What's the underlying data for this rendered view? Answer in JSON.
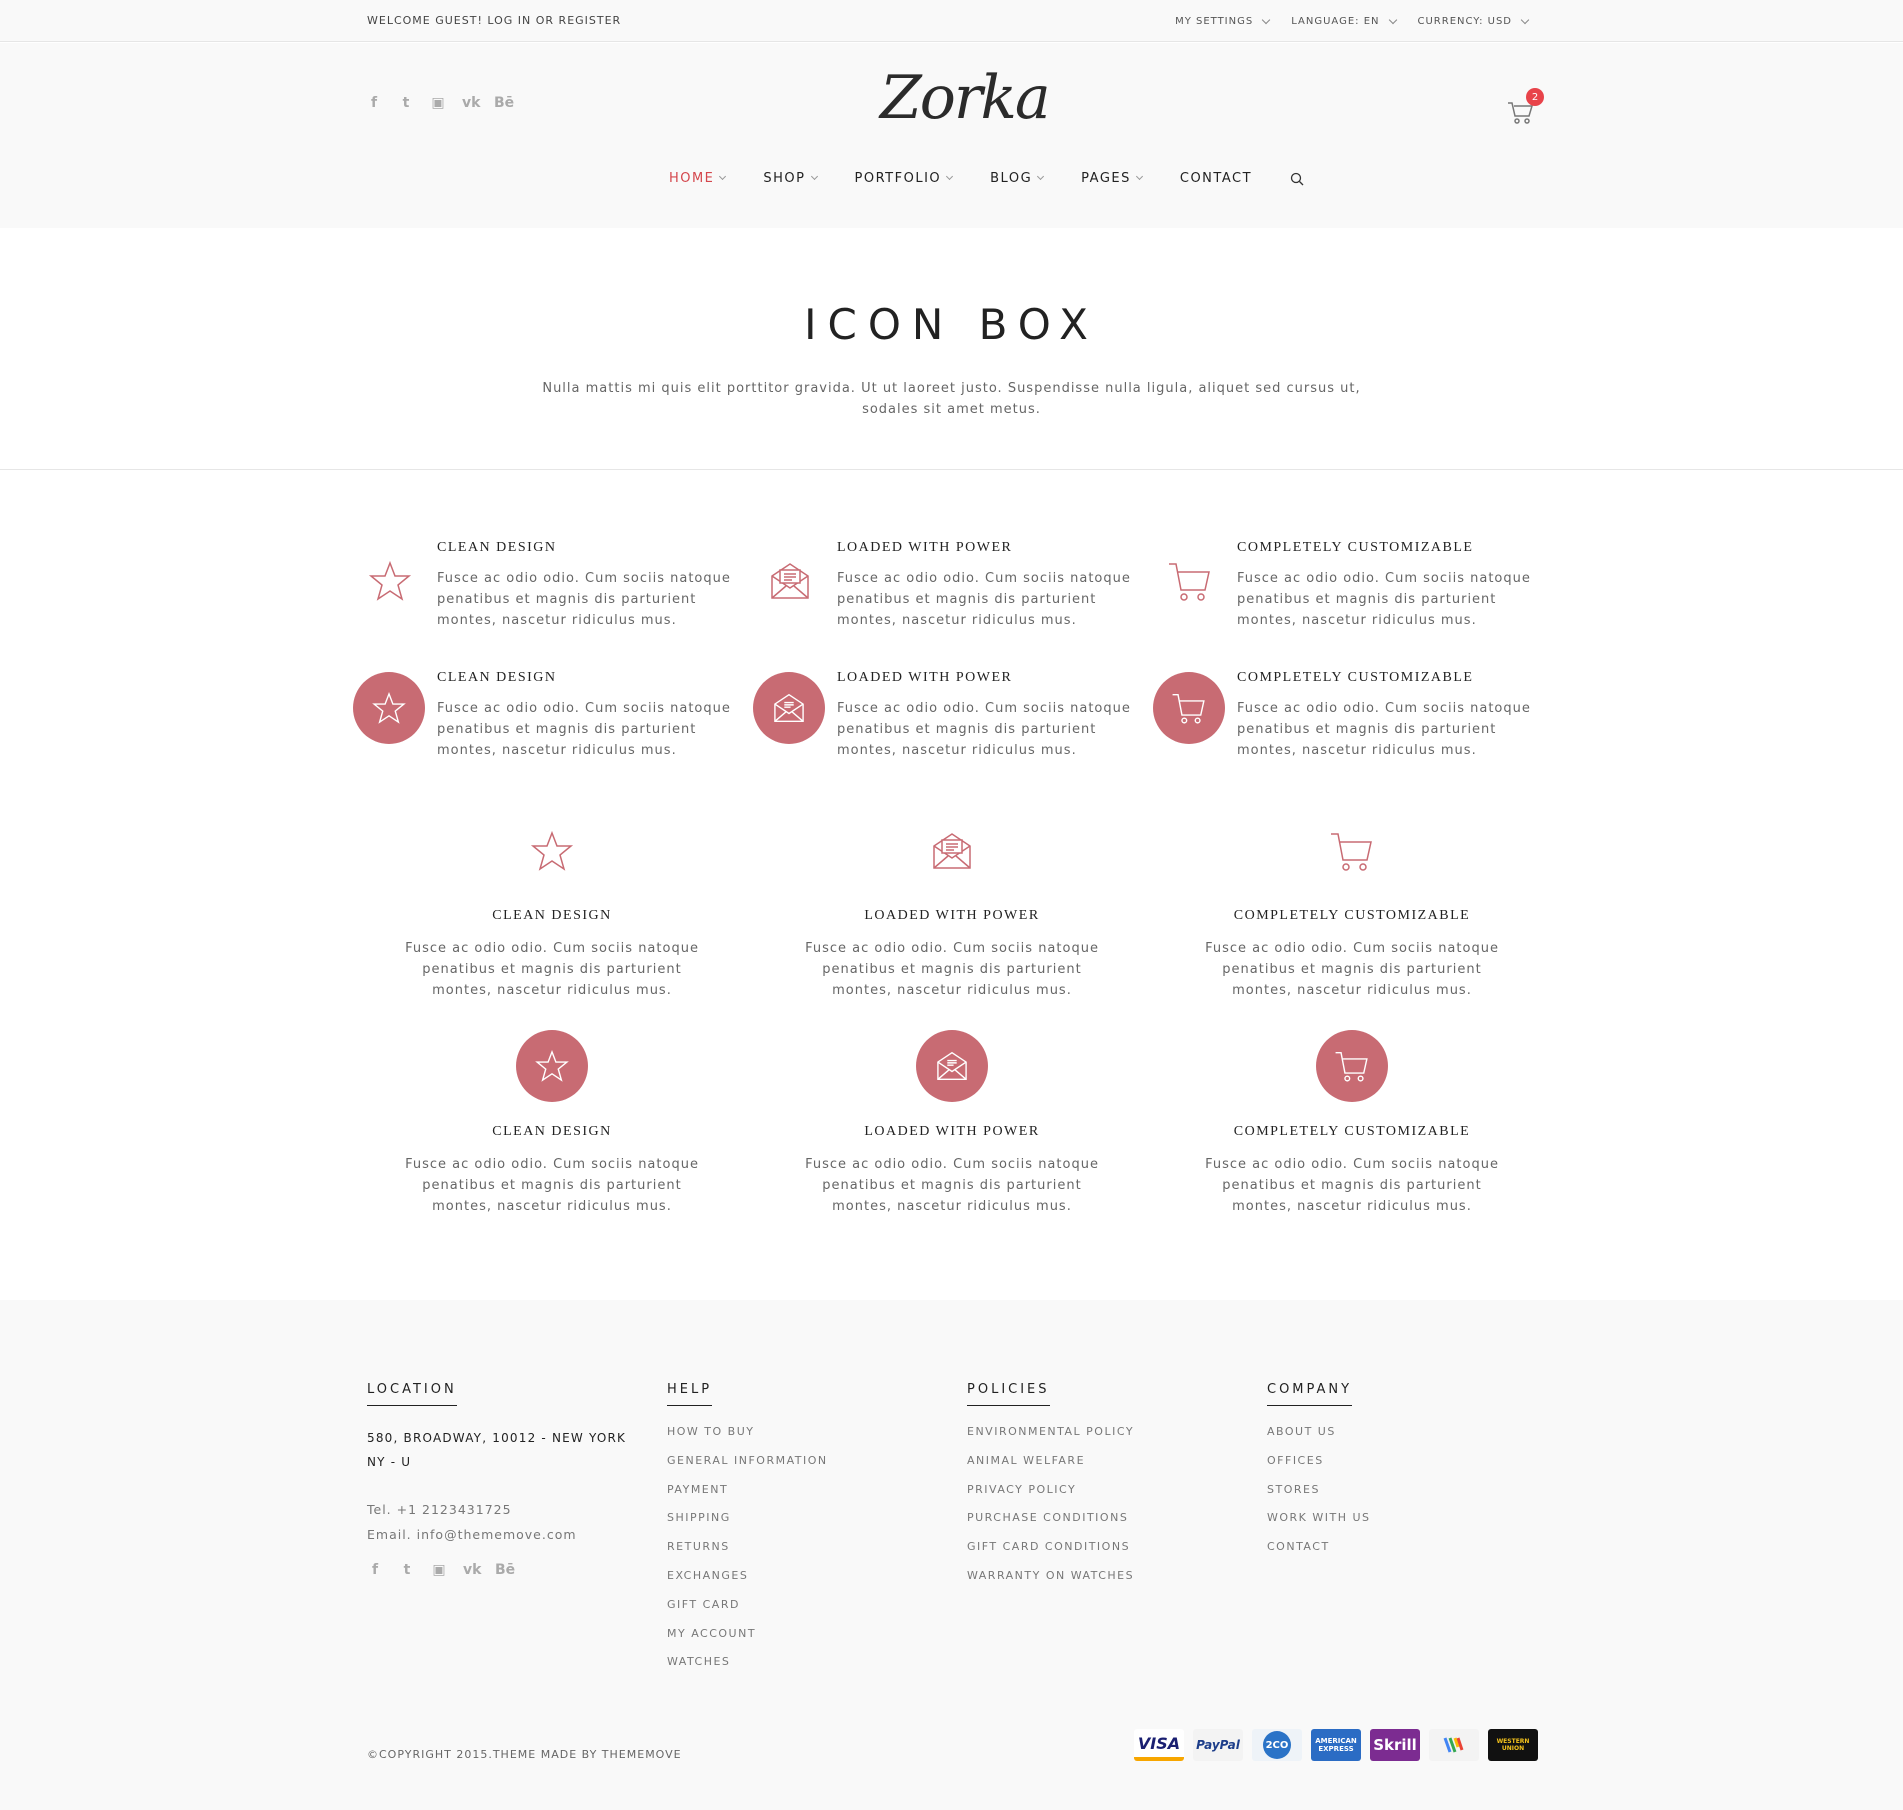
{
  "topbar": {
    "welcome": "WELCOME GUEST! LOG IN OR REGISTER",
    "settings": [
      "MY SETTINGS",
      "LANGUAGE: EN",
      "CURRENCY: USD"
    ]
  },
  "header": {
    "logo": "Zorka",
    "cart_count": "2",
    "social_icons": [
      "facebook-icon",
      "twitter-icon",
      "instagram-icon",
      "vk-icon",
      "behance-icon"
    ]
  },
  "nav": {
    "items": [
      "HOME",
      "SHOP",
      "PORTFOLIO",
      "BLOG",
      "PAGES",
      "CONTACT"
    ],
    "active": "HOME"
  },
  "page": {
    "title": "ICON BOX",
    "subtitle": "Nulla mattis mi quis elit porttitor gravida. Ut ut laoreet justo. Suspendisse nulla ligula, aliquet sed cursus ut, sodales sit amet metus."
  },
  "boxes": [
    {
      "title": "CLEAN DESIGN",
      "icon": "star-icon",
      "text": "Fusce ac odio odio. Cum sociis natoque penatibus et magnis dis parturient montes, nascetur ridiculus mus."
    },
    {
      "title": "LOADED WITH POWER",
      "icon": "envelope-icon",
      "text": "Fusce ac odio odio. Cum sociis natoque penatibus et magnis dis parturient montes, nascetur ridiculus mus."
    },
    {
      "title": "COMPLETELY CUSTOMIZABLE",
      "icon": "cart-icon",
      "text": "Fusce ac odio odio. Cum sociis natoque penatibus et magnis dis parturient montes, nascetur ridiculus mus."
    }
  ],
  "colors": {
    "accent": "#c86b73",
    "nav_active": "#d4474d",
    "badge": "#e8434a"
  },
  "footer": {
    "location": {
      "heading": "LOCATION",
      "address": "580, BROADWAY, 10012 - NEW YORK NY - U",
      "tel": "Tel. +1 2123431725",
      "email": "Email. info@thememove.com"
    },
    "help": {
      "heading": "HELP",
      "items": [
        "HOW TO BUY",
        "GENERAL INFORMATION",
        "PAYMENT",
        "SHIPPING",
        "RETURNS",
        "EXCHANGES",
        "GIFT CARD",
        "MY ACCOUNT",
        "WATCHES"
      ]
    },
    "policies": {
      "heading": "POLICIES",
      "items": [
        "ENVIRONMENTAL POLICY",
        "ANIMAL WELFARE",
        "PRIVACY POLICY",
        "PURCHASE CONDITIONS",
        "GIFT CARD CONDITIONS",
        "WARRANTY ON WATCHES"
      ]
    },
    "company": {
      "heading": "COMPANY",
      "items": [
        "ABOUT US",
        "OFFICES",
        "STORES",
        "WORK WITH US",
        "CONTACT"
      ]
    },
    "copyright": "©COPYRIGHT 2015.THEME MADE BY THEMEMOVE",
    "payments": [
      "VISA",
      "PayPal",
      "2CO",
      "AMERICAN EXPRESS",
      "Skrill",
      "",
      "WESTERN UNION"
    ]
  }
}
